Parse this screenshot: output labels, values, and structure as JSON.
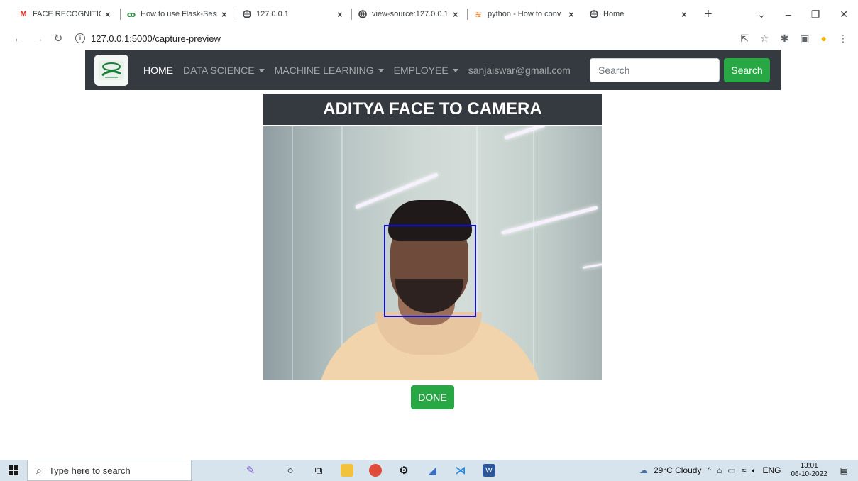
{
  "browser": {
    "tabs": [
      {
        "label": "FACE RECOGNITION T",
        "icon": "gmail-icon",
        "active": false
      },
      {
        "label": "How to use Flask-Sess",
        "icon": "gfg-icon",
        "active": false
      },
      {
        "label": "127.0.0.1",
        "icon": "globe-icon",
        "active": false
      },
      {
        "label": "view-source:127.0.0.1",
        "icon": "globe-icon",
        "active": false
      },
      {
        "label": "python - How to conv",
        "icon": "stackoverflow-icon",
        "active": false
      },
      {
        "label": "Home",
        "icon": "globe-icon",
        "active": true
      }
    ],
    "url": "127.0.0.1:5000/capture-preview"
  },
  "navbar": {
    "home": "HOME",
    "data_science": "DATA SCIENCE",
    "machine_learning": "MACHINE LEARNING",
    "employee": "EMPLOYEE",
    "email": "sanjaiswar@gmail.com",
    "search_placeholder": "Search",
    "search_button": "Search"
  },
  "page": {
    "title": "ADITYA FACE TO CAMERA",
    "done_button": "DONE"
  },
  "taskbar": {
    "search_placeholder": "Type here to search",
    "weather": "29°C  Cloudy",
    "language": "ENG",
    "time": "13:01",
    "date": "06-10-2022"
  },
  "colors": {
    "navbar_bg": "#343a40",
    "success_green": "#28a745",
    "face_box": "#1010d0"
  }
}
